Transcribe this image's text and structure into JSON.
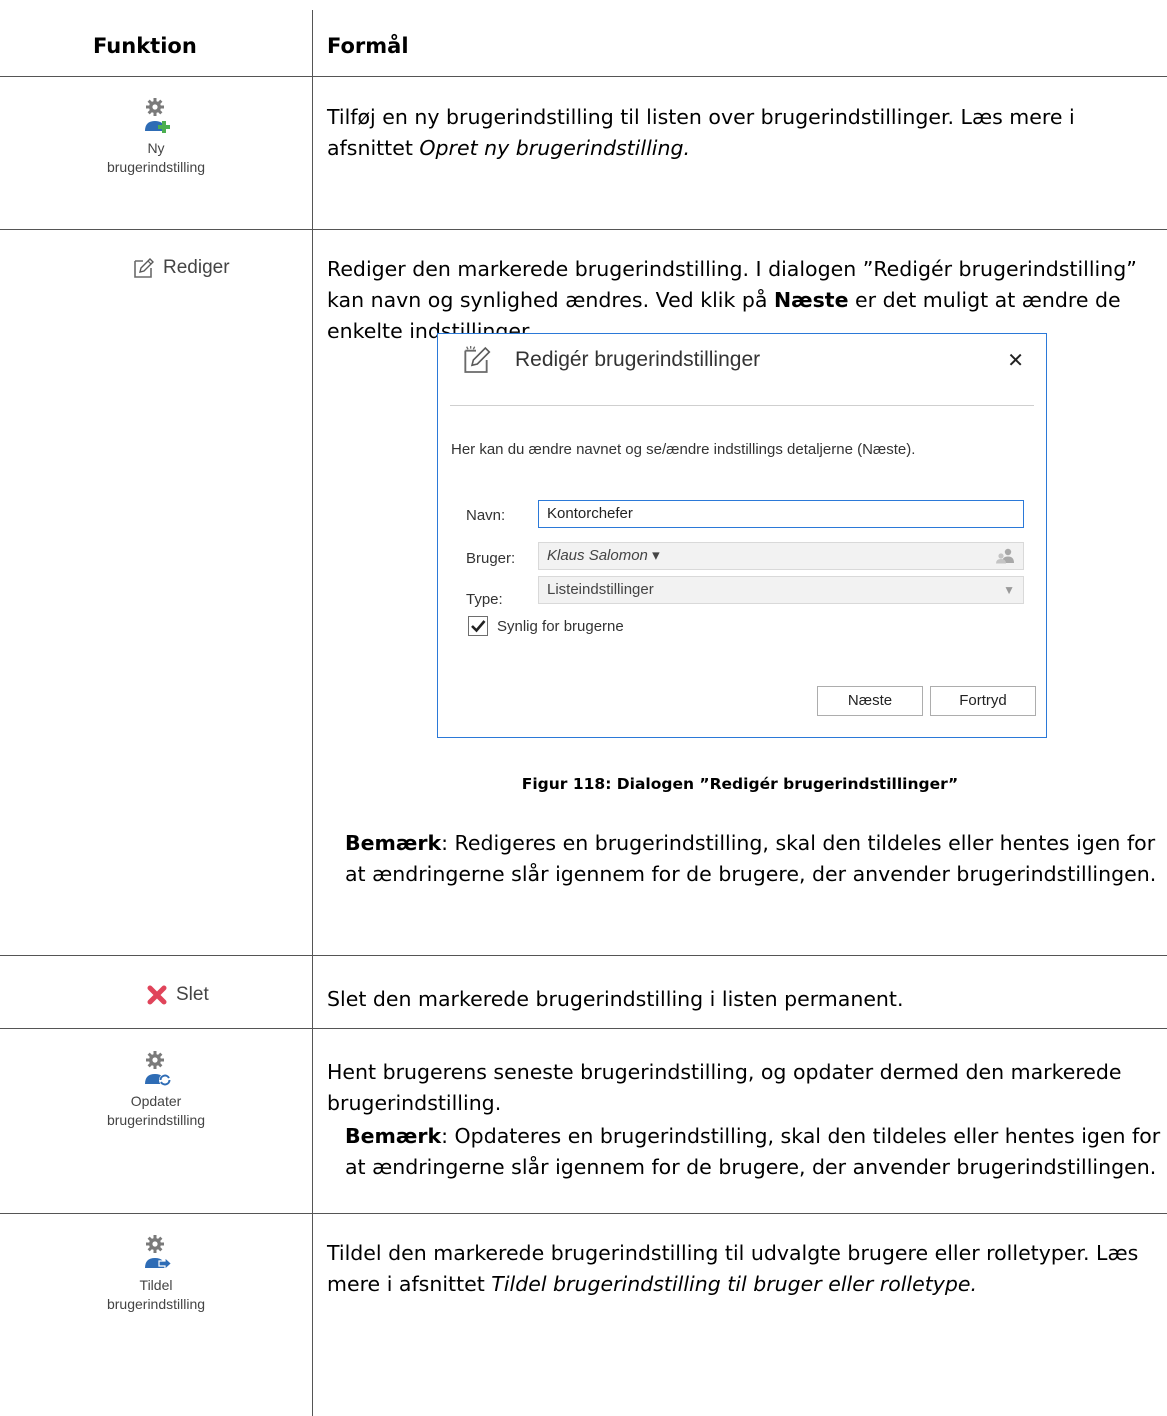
{
  "table": {
    "col_function": "Funktion",
    "col_purpose": "Formål"
  },
  "rows": {
    "ny": {
      "label_line1": "Ny",
      "label_line2": "brugerindstilling",
      "text_before_italic": "Tilføj en ny brugerindstilling til listen over brugerindstillinger. Læs mere i afsnittet ",
      "italic_ref": "Opret ny brugerindstilling."
    },
    "rediger": {
      "label": "Rediger",
      "text_part1": "Rediger den markerede brugerindstilling. I dialogen ”Redigér brugerindstilling” kan navn og synlighed ændres. Ved klik på ",
      "bold_word": "Næste",
      "text_part2": " er det muligt at ændre de enkelte indstillinger.",
      "dialog": {
        "title": "Redigér brugerindstillinger",
        "close_glyph": "✕",
        "info": "Her kan du ændre navnet og se/ændre indstillings detaljerne (Næste).",
        "name_label": "Navn:",
        "name_value": "Kontorchefer",
        "user_label": "Bruger:",
        "user_value": "Klaus Salomon",
        "user_caret": "▾",
        "type_label": "Type:",
        "type_value": "Listeindstillinger",
        "type_caret": "▼",
        "checkbox_label": "Synlig for brugerne",
        "checkbox_checked": true,
        "next_button": "Næste",
        "cancel_button": "Fortryd"
      },
      "caption": "Figur 118: Dialogen ”Redigér brugerindstillinger”",
      "note_bold": "Bemærk",
      "note_text": ": Redigeres en brugerindstilling, skal den tildeles eller hentes igen for at ændringerne slår igennem for de brugere, der anvender brugerindstillingen."
    },
    "slet": {
      "label": "Slet",
      "text": "Slet den markerede brugerindstilling i listen permanent."
    },
    "opdater": {
      "label_line1": "Opdater",
      "label_line2": "brugerindstilling",
      "text": "Hent brugerens seneste brugerindstilling, og opdater dermed den markerede brugerindstilling.",
      "note_bold": "Bemærk",
      "note_text": ": Opdateres en brugerindstilling, skal den tildeles eller hentes igen for at ændringerne slår igennem for de brugere, der anvender brugerindstillingen."
    },
    "tildel": {
      "label_line1": "Tildel",
      "label_line2": "brugerindstilling",
      "text_before_italic": "Tildel den markerede brugerindstilling til udvalgte brugere eller rolletyper. Læs mere i afsnittet ",
      "italic_ref": "Tildel brugerindstilling til bruger eller rolletype."
    }
  },
  "icons": {
    "ny": "gear-person-add-icon",
    "rediger": "edit-pencil-icon",
    "slet": "delete-x-icon",
    "opdater": "gear-person-refresh-icon",
    "tildel": "gear-person-assign-icon",
    "user_picker": "user-picker-icon"
  },
  "colors": {
    "gear": "#7a7a7a",
    "person": "#2e6cb5",
    "plus": "#4caf50",
    "delete": "#e0445a",
    "dialog_border": "#2b79d8"
  }
}
